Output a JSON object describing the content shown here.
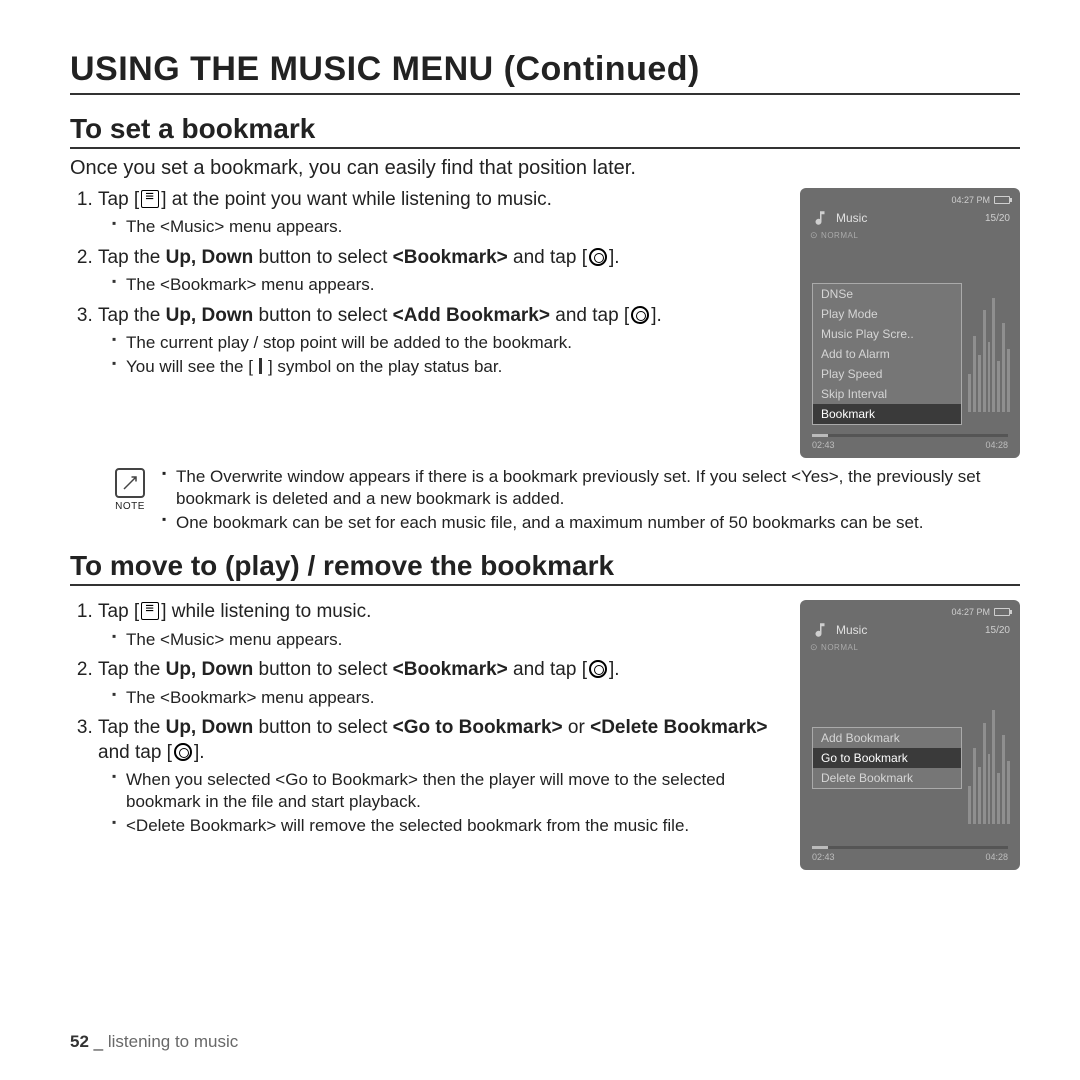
{
  "page_title": "USING THE MUSIC MENU (Continued)",
  "section1": {
    "title": "To set a bookmark",
    "intro": "Once you set a bookmark, you can easily find that position later.",
    "step1_a": "Tap [",
    "step1_b": "] at the point you want while listening to music.",
    "step1_sub1": "The <Music> menu appears.",
    "step2_a": "Tap the ",
    "step2_b": "Up, Down",
    "step2_c": " button to select ",
    "step2_d": "<Bookmark>",
    "step2_e": " and tap [",
    "step2_f": "].",
    "step2_sub1": "The <Bookmark> menu appears.",
    "step3_a": "Tap the ",
    "step3_b": "Up, Down",
    "step3_c": " button to select ",
    "step3_d": "<Add Bookmark>",
    "step3_e": " and tap [",
    "step3_f": "].",
    "step3_sub1": "The current play / stop point will be added to the bookmark.",
    "step3_sub2_a": "You will see the [",
    "step3_sub2_b": "] symbol on the play status bar.",
    "note_label": "NOTE",
    "note1": "The Overwrite window appears if there is a bookmark previously set. If you select <Yes>, the previously set bookmark is deleted and a new bookmark is added.",
    "note2": "One bookmark can be set for each music file, and a maximum number of 50 bookmarks can be set."
  },
  "section2": {
    "title": "To move to (play) / remove the bookmark",
    "step1_a": "Tap [",
    "step1_b": "] while listening to music.",
    "step1_sub1": "The <Music> menu appears.",
    "step2_a": "Tap the ",
    "step2_b": "Up, Down",
    "step2_c": " button to select ",
    "step2_d": "<Bookmark>",
    "step2_e": " and tap [",
    "step2_f": "].",
    "step2_sub1": "The <Bookmark> menu appears.",
    "step3_a": "Tap the ",
    "step3_b": "Up, Down",
    "step3_c": " button to select ",
    "step3_d": "<Go to Bookmark>",
    "step3_e": " or ",
    "step3_f": "<Delete Bookmark>",
    "step3_g": " and tap [",
    "step3_h": "].",
    "step3_sub1": "When you selected <Go to Bookmark> then the player will move to the selected bookmark in the file and start playback.",
    "step3_sub2": "<Delete Bookmark> will remove the selected bookmark from the music file."
  },
  "device": {
    "time": "04:27 PM",
    "title": "Music",
    "count": "15/20",
    "normal": "NORMAL",
    "time_left": "02:43",
    "time_right": "04:28",
    "menu1": {
      "items": [
        "DNSe",
        "Play Mode",
        "Music Play Scre..",
        "Add to Alarm",
        "Play Speed",
        "Skip Interval",
        "Bookmark"
      ],
      "selected": "Bookmark"
    },
    "menu2": {
      "items": [
        "Add Bookmark",
        "Go to Bookmark",
        "Delete Bookmark"
      ],
      "selected": "Go to Bookmark"
    }
  },
  "footer": {
    "page": "52",
    "sep": "_",
    "section": "listening to music"
  }
}
